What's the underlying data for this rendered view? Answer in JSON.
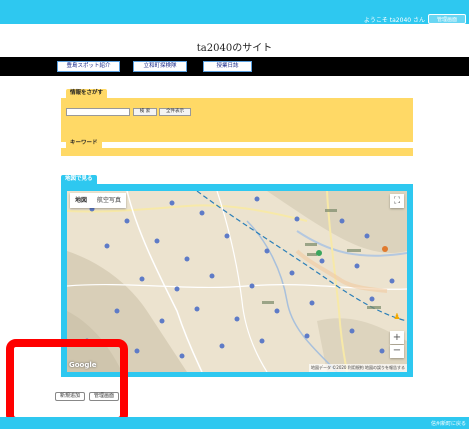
{
  "header": {
    "welcome": "ようこそ ta2040 さん",
    "admin_button": "管理画面"
  },
  "site": {
    "title": "ta2040のサイト"
  },
  "nav": {
    "items": [
      "豊島スポット紹介",
      "立和町探検隊",
      "授業日誌"
    ]
  },
  "search": {
    "label": "情報をさがす",
    "input_value": "",
    "search_button": "検 索",
    "show_all_button": "全件表示"
  },
  "keyword": {
    "label": "キーワード"
  },
  "map": {
    "label": "地図で見る",
    "type_map": "地図",
    "type_satellite": "航空写真",
    "google": "Google",
    "attribution": "地図データ ©2020  利用規約  地図の誤りを報告する"
  },
  "actions": {
    "add_button": "新規追加",
    "admin_button": "管理画面"
  },
  "footer": {
    "link": "信州新町に戻る"
  },
  "colors": {
    "accent": "#2ec8f0",
    "panel": "#ffd966",
    "highlight": "#ff0000"
  }
}
